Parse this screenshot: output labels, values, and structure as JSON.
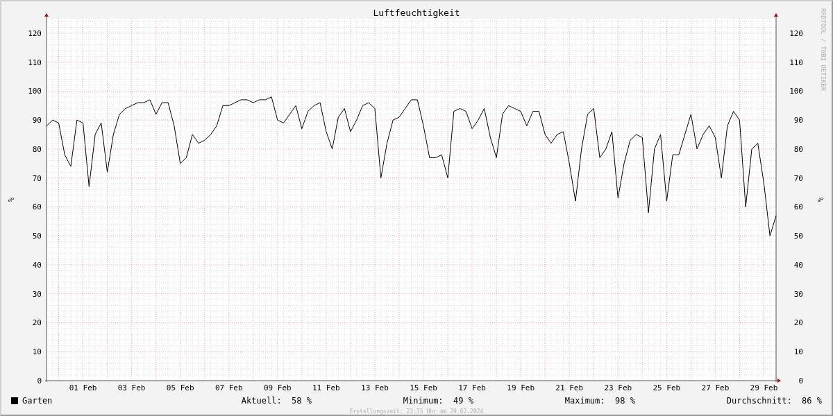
{
  "credit": "RRDTOOL / TOBI OETIKER",
  "chart_data": {
    "type": "line",
    "grid": true,
    "title": "Luftfeuchtigkeit",
    "ylabel": "%",
    "ylim": [
      0,
      125
    ],
    "yticks": [
      0,
      10,
      20,
      30,
      40,
      50,
      60,
      70,
      80,
      90,
      100,
      110,
      120
    ],
    "categories": [
      null,
      null,
      null,
      null,
      null,
      null,
      "01 Feb",
      null,
      null,
      null,
      null,
      null,
      null,
      null,
      "03 Feb",
      null,
      null,
      null,
      null,
      null,
      null,
      null,
      "05 Feb",
      null,
      null,
      null,
      null,
      null,
      null,
      null,
      "07 Feb",
      null,
      null,
      null,
      null,
      null,
      null,
      null,
      "09 Feb",
      null,
      null,
      null,
      null,
      null,
      null,
      null,
      "11 Feb",
      null,
      null,
      null,
      null,
      null,
      null,
      null,
      "13 Feb",
      null,
      null,
      null,
      null,
      null,
      null,
      null,
      "15 Feb",
      null,
      null,
      null,
      null,
      null,
      null,
      null,
      "17 Feb",
      null,
      null,
      null,
      null,
      null,
      null,
      null,
      "19 Feb",
      null,
      null,
      null,
      null,
      null,
      null,
      null,
      "21 Feb",
      null,
      null,
      null,
      null,
      null,
      null,
      null,
      "23 Feb",
      null,
      null,
      null,
      null,
      null,
      null,
      null,
      "25 Feb",
      null,
      null,
      null,
      null,
      null,
      null,
      null,
      "27 Feb",
      null,
      null,
      null,
      null,
      null,
      null,
      null,
      "29 Feb",
      null,
      null
    ],
    "series": [
      {
        "name": "Garten",
        "color": "#000000",
        "values": [
          88,
          90,
          89,
          78,
          74,
          90,
          89,
          67,
          85,
          89,
          72,
          85,
          92,
          94,
          95,
          96,
          96,
          97,
          92,
          96,
          96,
          88,
          75,
          77,
          85,
          82,
          83,
          85,
          88,
          95,
          95,
          96,
          97,
          97,
          96,
          97,
          97,
          98,
          90,
          89,
          92,
          95,
          87,
          93,
          95,
          96,
          86,
          80,
          91,
          94,
          86,
          90,
          95,
          96,
          94,
          70,
          82,
          90,
          91,
          94,
          97,
          97,
          88,
          77,
          77,
          78,
          70,
          93,
          94,
          93,
          87,
          90,
          94,
          84,
          77,
          92,
          95,
          94,
          93,
          88,
          93,
          93,
          85,
          82,
          85,
          86,
          75,
          62,
          80,
          92,
          94,
          77,
          80,
          86,
          63,
          75,
          83,
          85,
          84,
          58,
          80,
          85,
          62,
          78,
          78,
          85,
          92,
          80,
          85,
          88,
          84,
          70,
          88,
          93,
          90,
          60,
          80,
          82,
          68,
          50,
          57
        ]
      }
    ]
  },
  "right_axis": {
    "label": "%",
    "ticks": [
      "120",
      "110",
      "100",
      "90",
      "80",
      "70",
      "60",
      "50",
      "40",
      "30",
      "20",
      "10",
      "0"
    ]
  },
  "legend": {
    "stats": [
      {
        "label": "Aktuell:",
        "value": "58 %"
      },
      {
        "label": "Minimum:",
        "value": "49 %"
      },
      {
        "label": "Maximum:",
        "value": "98 %"
      },
      {
        "label": "Durchschnitt:",
        "value": "86 %"
      }
    ]
  },
  "footer": "Erstellungszeit: 23:55 Uhr am 29.02.2024"
}
